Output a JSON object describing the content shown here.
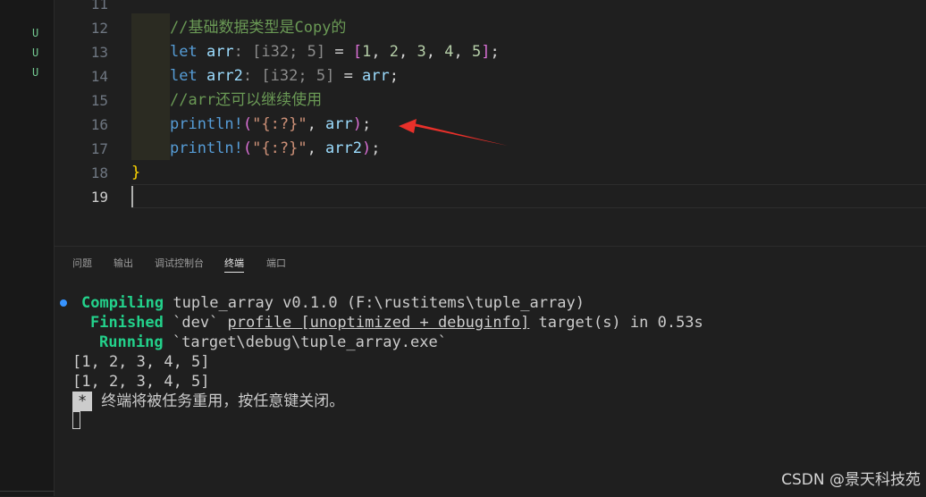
{
  "git_status": [
    "U",
    "U",
    "U"
  ],
  "editor": {
    "lines": [
      {
        "num": "11",
        "tokens": []
      },
      {
        "num": "12",
        "tokens": [
          {
            "t": "//基础数据类型是Copy的",
            "c": "c-comment"
          }
        ]
      },
      {
        "num": "13",
        "tokens": [
          {
            "t": "let ",
            "c": "c-kw"
          },
          {
            "t": "arr",
            "c": "c-var"
          },
          {
            "t": ": [",
            "c": "c-dim"
          },
          {
            "t": "i32",
            "c": "c-dim"
          },
          {
            "t": "; ",
            "c": "c-dim"
          },
          {
            "t": "5",
            "c": "c-dim"
          },
          {
            "t": "] ",
            "c": "c-dim"
          },
          {
            "t": "= ",
            "c": "c-punct"
          },
          {
            "t": "[",
            "c": "c-b1"
          },
          {
            "t": "1",
            "c": "c-num"
          },
          {
            "t": ", ",
            "c": "c-punct"
          },
          {
            "t": "2",
            "c": "c-num"
          },
          {
            "t": ", ",
            "c": "c-punct"
          },
          {
            "t": "3",
            "c": "c-num"
          },
          {
            "t": ", ",
            "c": "c-punct"
          },
          {
            "t": "4",
            "c": "c-num"
          },
          {
            "t": ", ",
            "c": "c-punct"
          },
          {
            "t": "5",
            "c": "c-num"
          },
          {
            "t": "]",
            "c": "c-b1"
          },
          {
            "t": ";",
            "c": "c-punct"
          }
        ]
      },
      {
        "num": "14",
        "tokens": [
          {
            "t": "let ",
            "c": "c-kw"
          },
          {
            "t": "arr2",
            "c": "c-var"
          },
          {
            "t": ": [",
            "c": "c-dim"
          },
          {
            "t": "i32",
            "c": "c-dim"
          },
          {
            "t": "; ",
            "c": "c-dim"
          },
          {
            "t": "5",
            "c": "c-dim"
          },
          {
            "t": "] ",
            "c": "c-dim"
          },
          {
            "t": "= ",
            "c": "c-punct"
          },
          {
            "t": "arr",
            "c": "c-var"
          },
          {
            "t": ";",
            "c": "c-punct"
          }
        ]
      },
      {
        "num": "15",
        "tokens": [
          {
            "t": "//arr还可以继续使用",
            "c": "c-comment"
          }
        ]
      },
      {
        "num": "16",
        "tokens": [
          {
            "t": "println!",
            "c": "c-macro"
          },
          {
            "t": "(",
            "c": "c-b1"
          },
          {
            "t": "\"{:?}\"",
            "c": "c-str"
          },
          {
            "t": ", ",
            "c": "c-punct"
          },
          {
            "t": "arr",
            "c": "c-var"
          },
          {
            "t": ")",
            "c": "c-b1"
          },
          {
            "t": ";",
            "c": "c-punct"
          }
        ]
      },
      {
        "num": "17",
        "tokens": [
          {
            "t": "println!",
            "c": "c-macro"
          },
          {
            "t": "(",
            "c": "c-b1"
          },
          {
            "t": "\"{:?}\"",
            "c": "c-str"
          },
          {
            "t": ", ",
            "c": "c-punct"
          },
          {
            "t": "arr2",
            "c": "c-var"
          },
          {
            "t": ")",
            "c": "c-b1"
          },
          {
            "t": ";",
            "c": "c-punct"
          }
        ]
      },
      {
        "num": "18",
        "tokens": [
          {
            "t": "}",
            "c": "c-b2"
          }
        ]
      },
      {
        "num": "19",
        "tokens": []
      }
    ]
  },
  "panel": {
    "tabs": [
      "问题",
      "输出",
      "调试控制台",
      "终端",
      "端口"
    ],
    "active_tab": "终端",
    "terminal": {
      "compiling_label": "Compiling",
      "compiling_text": " tuple_array v0.1.0 (F:\\rustitems\\tuple_array)",
      "finished_label": "Finished",
      "finished_pre": " `dev` ",
      "finished_underlined": "profile [unoptimized + debuginfo]",
      "finished_post": " target(s) in 0.53s",
      "running_label": "Running",
      "running_text": " `target\\debug\\tuple_array.exe`",
      "output_lines": [
        "[1, 2, 3, 4, 5]",
        "[1, 2, 3, 4, 5]"
      ],
      "reuse_badge": "*",
      "reuse_message": "终端将被任务重用，按任意键关闭。"
    }
  },
  "watermark": "CSDN @景天科技苑",
  "colors": {
    "background": "#1f1f1f",
    "annotation_arrow": "#e8302a",
    "terminal_green": "#23d18b",
    "git_untracked": "#73c991"
  }
}
